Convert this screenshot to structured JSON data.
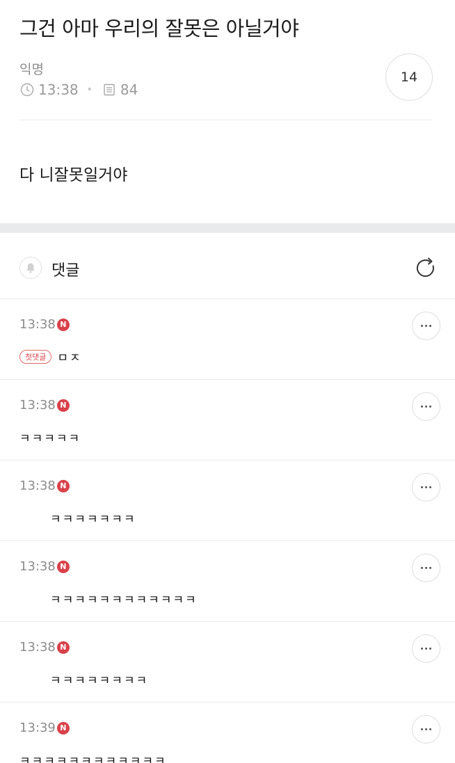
{
  "post": {
    "title": "그건 아마 우리의 잘못은 아닐거야",
    "author": "익명",
    "time": "13:38",
    "views": "84",
    "comment_count": "14",
    "body": "다 니잘못일거야"
  },
  "comments_section": {
    "label": "댓글"
  },
  "new_badge_label": "N",
  "first_comment_badge": "첫댓글",
  "comments": [
    {
      "time": "13:38",
      "text": "ㅁㅈ"
    },
    {
      "time": "13:38",
      "text": "ㅋㅋㅋㅋㅋ"
    },
    {
      "time": "13:38",
      "text": "ㅋㅋㅋㅋㅋㅋㅋ"
    },
    {
      "time": "13:38",
      "text": "ㅋㅋㅋㅋㅋㅋㅋㅋㅋㅋㅋㅋ"
    },
    {
      "time": "13:38",
      "text": "ㅋㅋㅋㅋㅋㅋㅋㅋ"
    },
    {
      "time": "13:39",
      "text": "ㅋㅋㅋㅋㅋㅋㅋㅋㅋㅋㅋㅋ"
    }
  ]
}
